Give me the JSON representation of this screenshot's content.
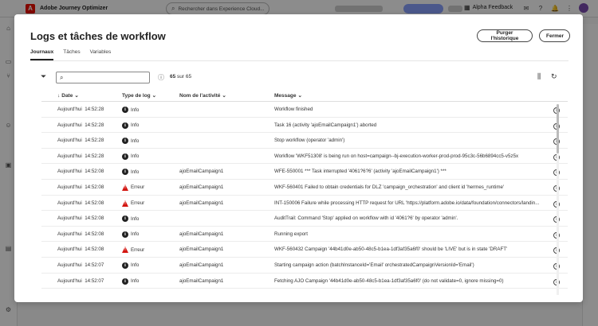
{
  "topbar": {
    "app_title": "Adobe Journey Optimizer",
    "search_placeholder": "Rechercher dans Experience Cloud...",
    "feedback_label": "Alpha Feedback"
  },
  "dialog": {
    "title": "Logs et tâches de workflow",
    "purge_button": "Purger l'historique",
    "close_button": "Fermer",
    "tabs": [
      {
        "label": "Journaux",
        "active": true
      },
      {
        "label": "Tâches",
        "active": false
      },
      {
        "label": "Variables",
        "active": false
      }
    ],
    "search_value": "",
    "count_shown": "65",
    "count_text": "sur 65",
    "columns": {
      "date": "Date",
      "type": "Type de log",
      "activity": "Nom de l'activité",
      "message": "Message"
    },
    "rows": [
      {
        "date": "Aujourd'hui",
        "time": "14:52:28",
        "type": "Info",
        "level": "info",
        "activity": "",
        "message": "Workflow finished"
      },
      {
        "date": "Aujourd'hui",
        "time": "14:52:28",
        "type": "Info",
        "level": "info",
        "activity": "",
        "message": "Task 16 (activity 'ajoEmailCampaign1') aborted"
      },
      {
        "date": "Aujourd'hui",
        "time": "14:52:28",
        "type": "Info",
        "level": "info",
        "activity": "",
        "message": "Stop workflow (operator 'admin')"
      },
      {
        "date": "Aujourd'hui",
        "time": "14:52:28",
        "type": "Info",
        "level": "info",
        "activity": "",
        "message": "Workflow 'WKF51308' is being run on host=campaign--bj-execution-worker-prod-prod-95c3c-56b6894cc5-v5z5x"
      },
      {
        "date": "Aujourd'hui",
        "time": "14:52:08",
        "type": "Info",
        "level": "info",
        "activity": "ajoEmailCampaign1",
        "message": "WFE-550001 *** Task interrupted '4061?6?6' (activity 'ajoEmailCampaign1') ***"
      },
      {
        "date": "Aujourd'hui",
        "time": "14:52:08",
        "type": "Erreur",
        "level": "error",
        "activity": "ajoEmailCampaign1",
        "message": "WKF-560401 Failed to obtain credentials for DLZ 'campaign_orchestration' and client id 'hermes_runtime'"
      },
      {
        "date": "Aujourd'hui",
        "time": "14:52:08",
        "type": "Erreur",
        "level": "error",
        "activity": "ajoEmailCampaign1",
        "message": "INT-150006 Failure while processing HTTP request for URL 'https://platform.adobe.io/data/foundation/connectors/landin..."
      },
      {
        "date": "Aujourd'hui",
        "time": "14:52:08",
        "type": "Info",
        "level": "info",
        "activity": "",
        "message": "AuditTrail: Command 'Stop' applied on workflow with id '4061?6' by operator 'admin'."
      },
      {
        "date": "Aujourd'hui",
        "time": "14:52:08",
        "type": "Info",
        "level": "info",
        "activity": "ajoEmailCampaign1",
        "message": "Running export"
      },
      {
        "date": "Aujourd'hui",
        "time": "14:52:08",
        "type": "Erreur",
        "level": "error",
        "activity": "ajoEmailCampaign1",
        "message": "WKF-560432 Campaign '44b41d0e-ab50-48c5-b1ea-1df3af35a6f0' should be 'LIVE' but is in state 'DRAFT'"
      },
      {
        "date": "Aujourd'hui",
        "time": "14:52:07",
        "type": "Info",
        "level": "info",
        "activity": "ajoEmailCampaign1",
        "message": "Starting campaign action (batchInstanceId='Email' orchestratedCampaignVersionId='Email')"
      },
      {
        "date": "Aujourd'hui",
        "time": "14:52:07",
        "type": "Info",
        "level": "info",
        "activity": "ajoEmailCampaign1",
        "message": "Fetching AJO Campaign '44b41d0e-ab50-48c5-b1ea-1df3af35a6f0' (do not validate=0, ignore missing=0)"
      }
    ]
  }
}
